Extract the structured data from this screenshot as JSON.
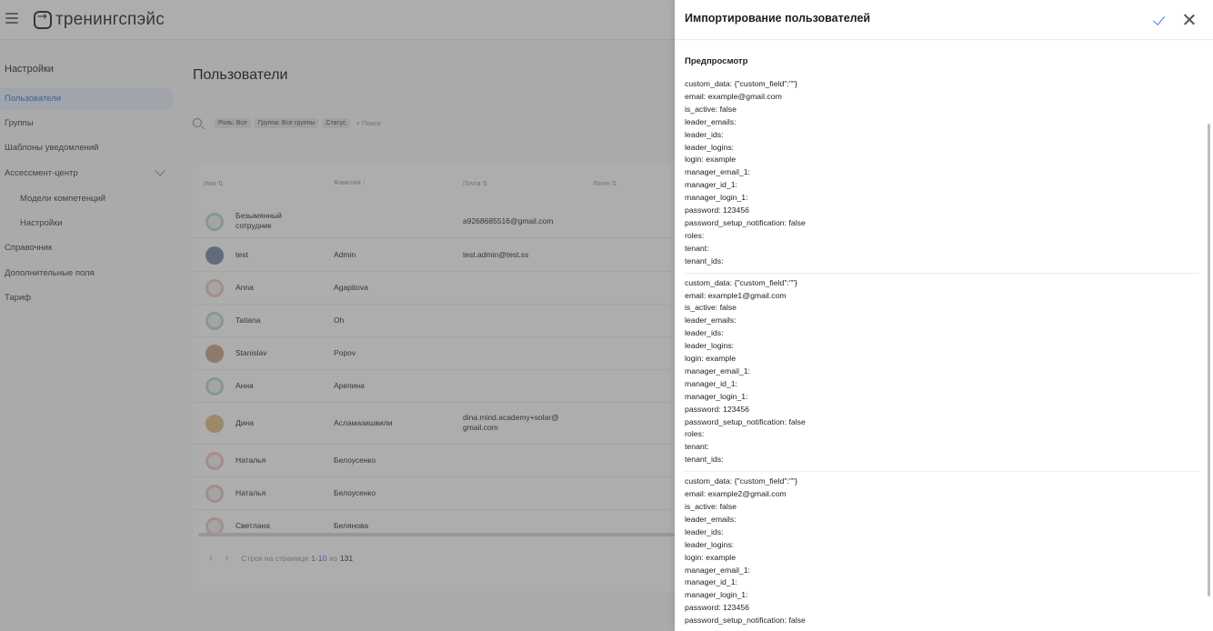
{
  "header": {
    "logo_text": "тренингспэйс"
  },
  "sidebar": {
    "title": "Настройки",
    "items": [
      {
        "label": "Пользователи"
      },
      {
        "label": "Группы"
      },
      {
        "label": "Шаблоны уведомлений"
      },
      {
        "label": "Ассессмент-центр"
      },
      {
        "label": "Модели компетенций"
      },
      {
        "label": "Настройки"
      },
      {
        "label": "Справочник"
      },
      {
        "label": "Дополнительные поля"
      },
      {
        "label": "Тариф"
      }
    ]
  },
  "main": {
    "title": "Пользователи",
    "filters": {
      "chips": [
        "Роль: Все",
        "Группа: Все группы",
        "Статус"
      ],
      "search_label": "+ Поиск"
    },
    "columns": [
      "Имя ⇅",
      "Фамилия ↑",
      "Почта ⇅",
      "Логин ⇅"
    ],
    "rows": [
      {
        "first": "Безымянный сотрудник",
        "last": "",
        "email": "a9268685516@gmail.com"
      },
      {
        "first": "test",
        "last": "Admin",
        "email": "test.admin@test.ss"
      },
      {
        "first": "Anna",
        "last": "Agapitova",
        "email": ""
      },
      {
        "first": "Tatiana",
        "last": "Oh",
        "email": ""
      },
      {
        "first": "Stanislav",
        "last": "Popov",
        "email": ""
      },
      {
        "first": "Анна",
        "last": "Арепина",
        "email": ""
      },
      {
        "first": "Дина",
        "last": "Асламазишвили",
        "email": "dina.mind.academy+solar@ gmail.com"
      },
      {
        "first": "Наталья",
        "last": "Белоусенко",
        "email": ""
      },
      {
        "first": "Наталья",
        "last": "Белоусенко",
        "email": ""
      },
      {
        "first": "Светлана",
        "last": "Белянова",
        "email": ""
      }
    ],
    "pagination": {
      "prefix": "Строк на странице",
      "range": "1-10",
      "of": "из",
      "total": "131"
    }
  },
  "drawer": {
    "title": "Импортирование пользователей",
    "preview_label": "Предпросмотр",
    "records": [
      [
        "custom_data: {\"custom_field\":\"\"}",
        "email: example@gmail.com",
        "is_active: false",
        "leader_emails:",
        "leader_ids:",
        "leader_logins:",
        "login: example",
        "manager_email_1:",
        "manager_id_1:",
        "manager_login_1:",
        "password: 123456",
        "password_setup_notification: false",
        "roles:",
        "tenant:",
        "tenant_ids:"
      ],
      [
        "custom_data: {\"custom_field\":\"\"}",
        "email: example1@gmail.com",
        "is_active: false",
        "leader_emails:",
        "leader_ids:",
        "leader_logins:",
        "login: example",
        "manager_email_1:",
        "manager_id_1:",
        "manager_login_1:",
        "password: 123456",
        "password_setup_notification: false",
        "roles:",
        "tenant:",
        "tenant_ids:"
      ],
      [
        "custom_data: {\"custom_field\":\"\"}",
        "email: example2@gmail.com",
        "is_active: false",
        "leader_emails:",
        "leader_ids:",
        "leader_logins:",
        "login: example",
        "manager_email_1:",
        "manager_id_1:",
        "manager_login_1:",
        "password: 123456",
        "password_setup_notification: false"
      ]
    ]
  }
}
